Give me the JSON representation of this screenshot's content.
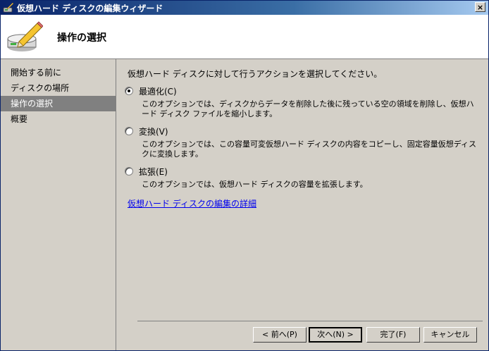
{
  "window": {
    "title": "仮想ハード ディスクの編集ウィザード",
    "close_glyph": "×"
  },
  "header": {
    "title": "操作の選択"
  },
  "sidebar": {
    "items": [
      {
        "label": "開始する前に"
      },
      {
        "label": "ディスクの場所"
      },
      {
        "label": "操作の選択"
      },
      {
        "label": "概要"
      }
    ],
    "selected_index": 2
  },
  "main": {
    "instruction": "仮想ハード ディスクに対して行うアクションを選択してください。",
    "options": [
      {
        "label": "最適化(C)",
        "description": "このオプションでは、ディスクからデータを削除した後に残っている空の領域を削除し、仮想ハード ディスク ファイルを縮小します。",
        "checked": true
      },
      {
        "label": "変換(V)",
        "description": "このオプションでは、この容量可変仮想ハード ディスクの内容をコピーし、固定容量仮想ディスクに変換します。",
        "checked": false
      },
      {
        "label": "拡張(E)",
        "description": "このオプションでは、仮想ハード ディスクの容量を拡張します。",
        "checked": false
      }
    ],
    "help_link": "仮想ハード ディスクの編集の詳細"
  },
  "buttons": {
    "back": "< 前へ(P)",
    "next": "次へ(N) >",
    "finish": "完了(F)",
    "cancel": "キャンセル"
  },
  "colors": {
    "titlebar": "#0a246a",
    "selected_nav": "#808080",
    "link": "#0000ee"
  }
}
